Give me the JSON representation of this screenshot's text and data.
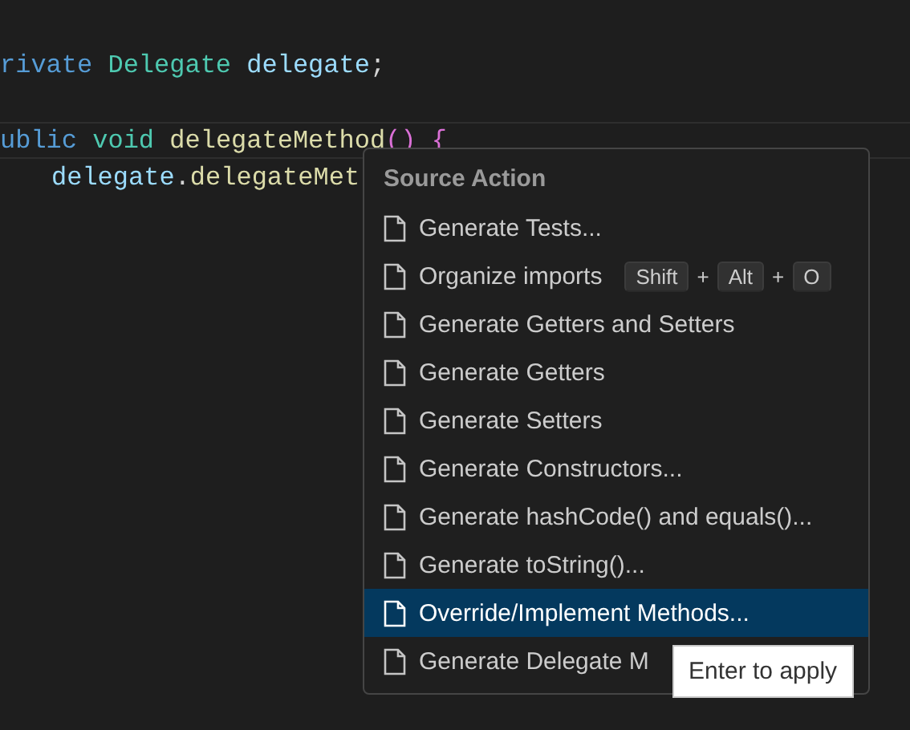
{
  "code_lines": [
    {
      "blank_line_before": true,
      "current": false,
      "indented": false,
      "tokens": [
        {
          "text": "rivate",
          "color": "#569cd6"
        },
        {
          "text": " Delegate",
          "color": "#4ec9b0"
        },
        {
          "text": " delegate",
          "color": "#9cdcfe"
        },
        {
          "text": ";",
          "color": "#d4d4d4"
        }
      ]
    },
    {
      "blank_line_before": true,
      "current": true,
      "indented": false,
      "tokens": [
        {
          "text": "ublic",
          "color": "#569cd6"
        },
        {
          "text": " void",
          "color": "#4ec9b0"
        },
        {
          "text": " delegateMethod",
          "color": "#dcdcaa"
        },
        {
          "text": "()",
          "color": "#da70d6"
        },
        {
          "text": " {",
          "color": "#da70d6"
        }
      ]
    },
    {
      "blank_line_before": false,
      "current": false,
      "indented": true,
      "tokens": [
        {
          "text": "delegate",
          "color": "#9cdcfe"
        },
        {
          "text": ".",
          "color": "#d4d4d4"
        },
        {
          "text": "delegateMet",
          "color": "#dcdcaa"
        }
      ]
    }
  ],
  "menu": {
    "title": "Source Action",
    "items": [
      {
        "label": "Generate Tests...",
        "selected": false
      },
      {
        "label": "Organize imports",
        "selected": false,
        "shortcut": [
          "Shift",
          "+",
          "Alt",
          "+",
          "O"
        ]
      },
      {
        "label": "Generate Getters and Setters",
        "selected": false
      },
      {
        "label": "Generate Getters",
        "selected": false
      },
      {
        "label": "Generate Setters",
        "selected": false
      },
      {
        "label": "Generate Constructors...",
        "selected": false
      },
      {
        "label": "Generate hashCode() and equals()...",
        "selected": false
      },
      {
        "label": "Generate toString()...",
        "selected": false
      },
      {
        "label": "Override/Implement Methods...",
        "selected": true
      },
      {
        "label": "Generate Delegate M",
        "selected": false
      }
    ]
  },
  "tooltip": "Enter to apply"
}
